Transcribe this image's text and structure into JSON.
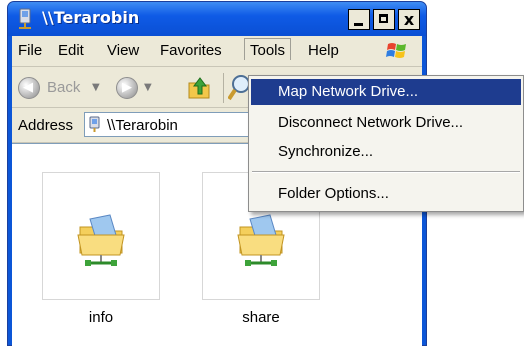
{
  "window": {
    "title": "\\\\Terarobin",
    "controls": {
      "minimize": "_",
      "maximize": "□",
      "close": "x"
    }
  },
  "menubar": {
    "items": [
      {
        "label": "File"
      },
      {
        "label": "Edit"
      },
      {
        "label": "View"
      },
      {
        "label": "Favorites"
      },
      {
        "label": "Tools"
      },
      {
        "label": "Help"
      }
    ],
    "active": "Tools"
  },
  "toolbar": {
    "back_label": "Back",
    "icons": [
      "back-icon",
      "forward-icon",
      "up-folder-icon",
      "search-icon"
    ]
  },
  "address": {
    "label": "Address",
    "value": "\\\\Terarobin"
  },
  "content": {
    "items": [
      {
        "label": "info",
        "icon": "network-share-icon"
      },
      {
        "label": "share",
        "icon": "network-share-icon"
      }
    ]
  },
  "tools_menu": {
    "items": [
      {
        "label": "Map Network Drive...",
        "highlighted": true
      },
      {
        "label": "Disconnect Network Drive...",
        "highlighted": false
      },
      {
        "label": "Synchronize...",
        "highlighted": false
      },
      {
        "label": "Folder Options...",
        "highlighted": false
      }
    ]
  },
  "colors": {
    "title_bar": "#0a4fd4",
    "menu_highlight": "#1e3c8f",
    "window_face": "#ece9d8"
  }
}
